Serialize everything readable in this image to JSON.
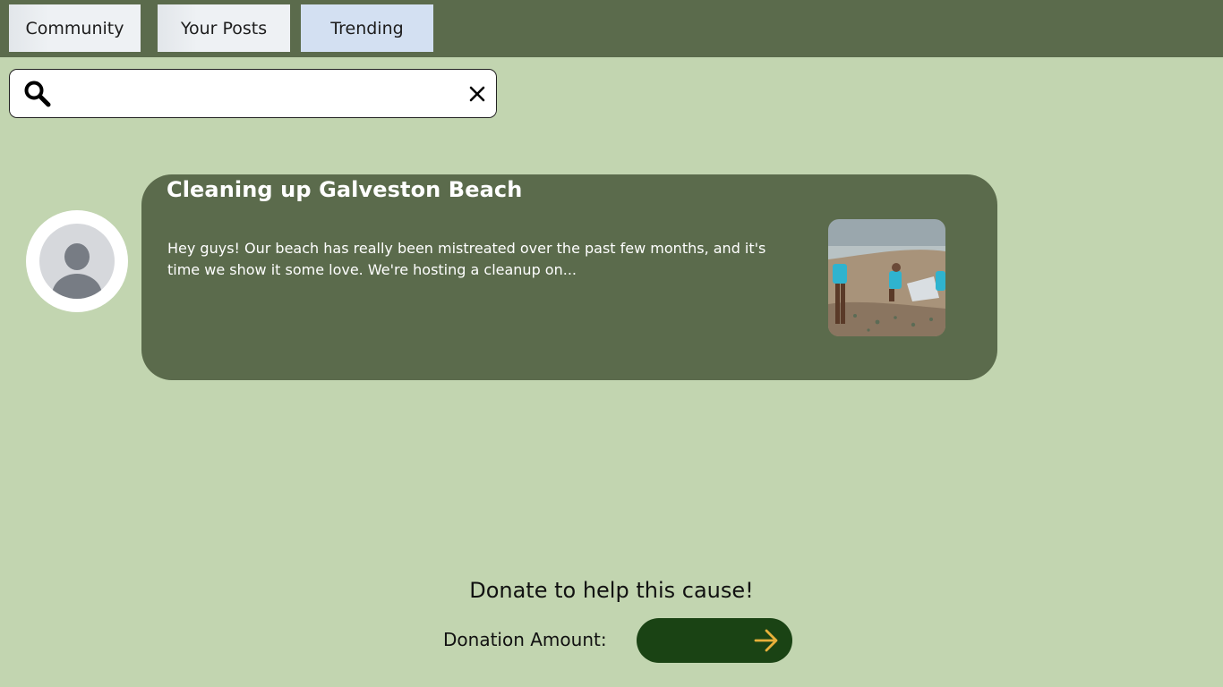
{
  "tabs": [
    {
      "label": "Community"
    },
    {
      "label": "Your Posts"
    },
    {
      "label": "Trending"
    }
  ],
  "search": {
    "value": "",
    "placeholder": "",
    "icon": "search-icon",
    "clear_icon": "close-icon"
  },
  "post": {
    "title": "Cleaning up Galveston Beach",
    "body": "Hey guys! Our beach has really been mistreated over the past few months, and it's time we show it some love. We're hosting a cleanup on...",
    "avatar_icon": "user-avatar-icon",
    "image": "beach-cleanup-photo"
  },
  "donation": {
    "heading": "Donate to help this cause!",
    "label": "Donation Amount:",
    "amount_value": "",
    "submit_icon": "arrow-right-icon"
  },
  "colors": {
    "background": "#c2d5b0",
    "header": "#5b6b4c",
    "card": "#5b6b4c",
    "donate_field": "#1a4314",
    "arrow": "#e8b03a",
    "tab_active": "#d3e0f2"
  }
}
